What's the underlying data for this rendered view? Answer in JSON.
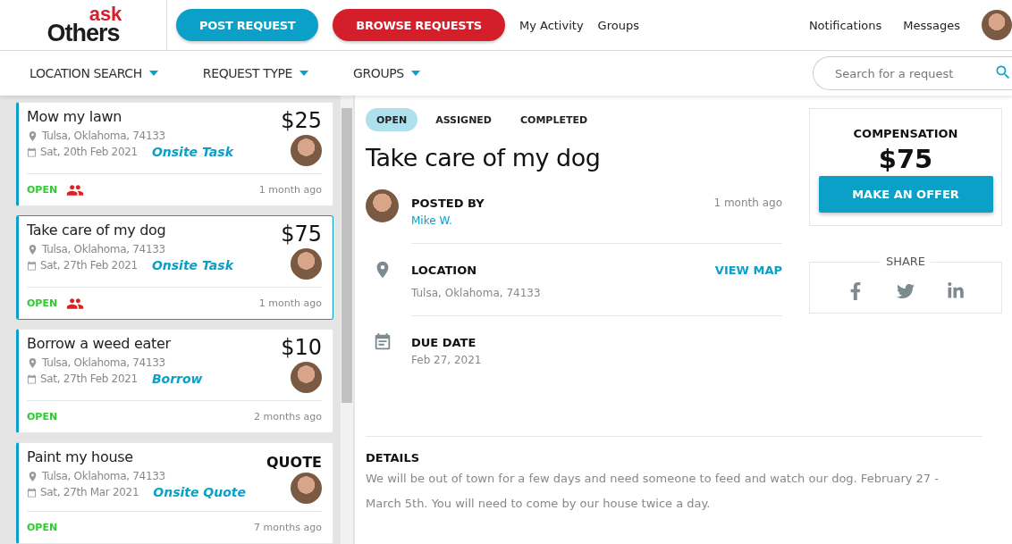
{
  "logo": {
    "top": "ask",
    "bottom": "Others"
  },
  "header": {
    "buttons": [
      {
        "label": "POST REQUEST",
        "kind": "primary"
      },
      {
        "label": "BROWSE REQUESTS",
        "kind": "danger"
      }
    ],
    "links": [
      "My Activity",
      "Groups"
    ],
    "right_links": [
      "Notifications",
      "Messages"
    ]
  },
  "filters": [
    "LOCATION SEARCH",
    "REQUEST TYPE",
    "GROUPS"
  ],
  "search": {
    "placeholder": "Search for a request"
  },
  "requests": [
    {
      "title": "Mow my lawn",
      "price": "$25",
      "location": "Tulsa, Oklahoma, 74133",
      "date": "Sat, 20th Feb 2021",
      "type": "Onsite Task",
      "status": "OPEN",
      "group": true,
      "age": "1 month ago",
      "selected": false
    },
    {
      "title": "Take care of my dog",
      "price": "$75",
      "location": "Tulsa, Oklahoma, 74133",
      "date": "Sat, 27th Feb 2021",
      "type": "Onsite Task",
      "status": "OPEN",
      "group": true,
      "age": "1 month ago",
      "selected": true
    },
    {
      "title": "Borrow a weed eater",
      "price": "$10",
      "location": "Tulsa, Oklahoma, 74133",
      "date": "Sat, 27th Feb 2021",
      "type": "Borrow",
      "status": "OPEN",
      "group": false,
      "age": "2 months ago",
      "selected": false
    },
    {
      "title": "Paint my house",
      "price": "QUOTE",
      "location": "Tulsa, Oklahoma, 74133",
      "date": "Sat, 27th Mar 2021",
      "type": "Onsite Quote",
      "status": "OPEN",
      "group": false,
      "age": "7 months ago",
      "selected": false
    }
  ],
  "detail": {
    "tabs": [
      {
        "label": "OPEN",
        "selected": true
      },
      {
        "label": "ASSIGNED",
        "selected": false
      },
      {
        "label": "COMPLETED",
        "selected": false
      }
    ],
    "title": "Take care of my dog",
    "posted_by": {
      "label": "POSTED BY",
      "name": "Mike W.",
      "age": "1 month ago"
    },
    "location": {
      "label": "LOCATION",
      "value": "Tulsa, Oklahoma, 74133",
      "action": "VIEW MAP"
    },
    "due_date": {
      "label": "DUE DATE",
      "value": "Feb 27, 2021"
    },
    "details": {
      "label": "DETAILS",
      "text": "We will be out of town for a few days and need someone to feed and watch our dog. February 27 - March 5th. You will need to come by our house twice a day."
    }
  },
  "compensation": {
    "label": "COMPENSATION",
    "amount": "$75",
    "button": "MAKE AN OFFER"
  },
  "share": {
    "label": "SHARE"
  }
}
